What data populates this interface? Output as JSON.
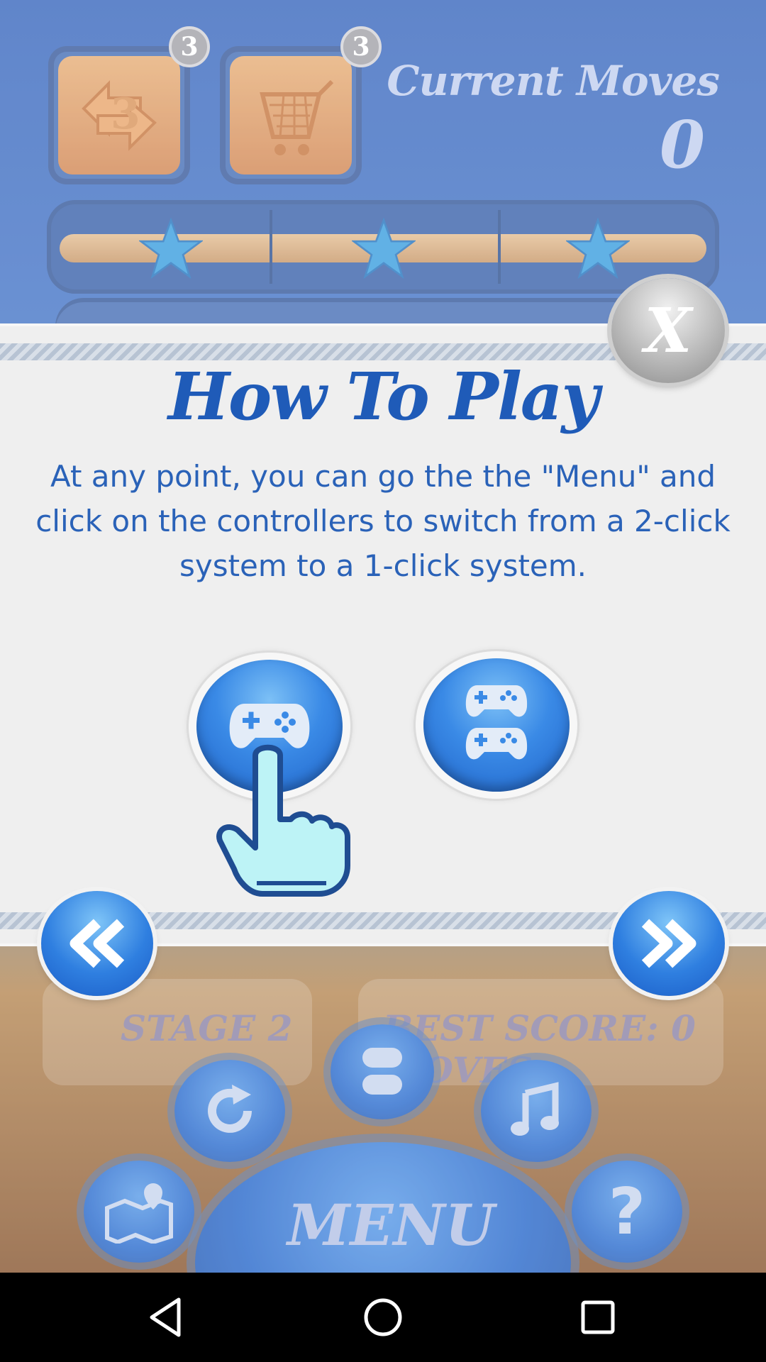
{
  "hud": {
    "powerups": [
      {
        "name": "shuffle",
        "count": "3"
      },
      {
        "name": "basket",
        "count": "3"
      }
    ],
    "moves_label": "Current Moves",
    "moves_value": "0",
    "stars_total": 3
  },
  "background": {
    "stage_label": "STAGE 2",
    "best_score_label": "BEST SCORE: 0 MOVES",
    "menu_label": "MENU"
  },
  "dialog": {
    "title": "How To Play",
    "body_lines": [
      "At any point, you can go the the \"Menu\" and",
      "click on the controllers to switch from a 2-click",
      "system to a 1-click system."
    ],
    "close_label": "X",
    "controllers": [
      {
        "mode": "1-click",
        "icon": "single-controller-icon"
      },
      {
        "mode": "2-click",
        "icon": "double-controller-icon"
      }
    ]
  },
  "colors": {
    "accent_blue": "#1f5bb8",
    "body_text": "#2a62b8",
    "panel_bg": "#efefef"
  }
}
